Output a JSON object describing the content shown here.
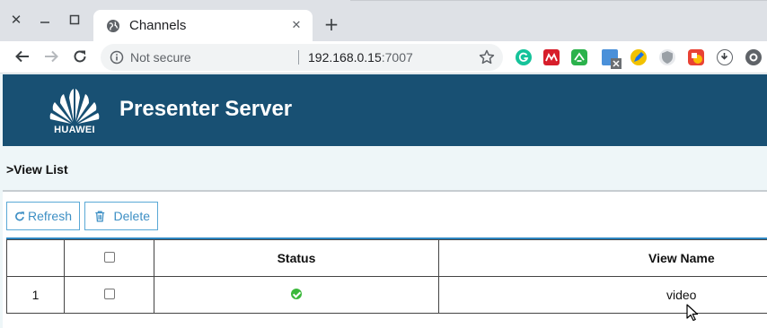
{
  "browser": {
    "tab_title": "Channels",
    "address": {
      "security_label": "Not secure",
      "host": "192.168.0.15",
      "port": ":7007"
    },
    "extensions": [
      "grammarly-icon",
      "mendeley-icon",
      "feedly-icon",
      "screenshot-icon",
      "pencil-icon",
      "shield-icon",
      "adblock-icon",
      "download-icon",
      "settings-extension-icon"
    ]
  },
  "header": {
    "brand": "HUAWEI",
    "title": "Presenter Server",
    "color": "#185073"
  },
  "breadcrumb": ">View List",
  "toolbar": {
    "refresh_label": "Refresh",
    "delete_label": "Delete"
  },
  "table": {
    "columns": [
      "",
      "",
      "Status",
      "View Name"
    ],
    "rows": [
      {
        "index": "1",
        "checked": false,
        "status": "ok",
        "view_name": "video"
      }
    ]
  },
  "colors": {
    "accent": "#3d8fc4",
    "status_ok": "#3bb83b"
  }
}
